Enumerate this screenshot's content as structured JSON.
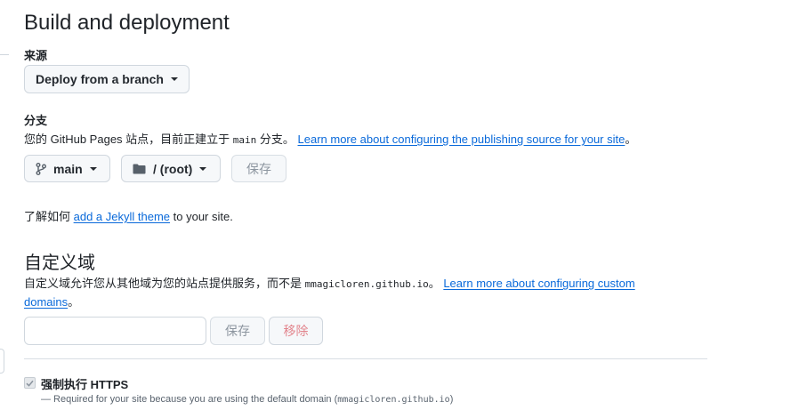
{
  "build": {
    "title": "Build and deployment",
    "source_label": "来源",
    "source_value": "Deploy from a branch"
  },
  "branch": {
    "label": "分支",
    "desc_prefix": "您的 GitHub Pages 站点，目前正建立于 ",
    "desc_code": "main",
    "desc_mid": " 分支。 ",
    "learn_link": "Learn more about configuring the publishing source for your site",
    "desc_end": "。",
    "branch_value": "main",
    "folder_value": "/ (root)",
    "save_label": "保存"
  },
  "jekyll": {
    "prefix": "了解如何 ",
    "link": "add a Jekyll theme",
    "suffix": " to your site."
  },
  "custom_domain": {
    "title": "自定义域",
    "desc_prefix": "自定义域允许您从其他域为您的站点提供服务，而不是 ",
    "desc_code": "mmagicloren.github.io",
    "desc_mid": "。 ",
    "learn_link_line1": "Learn more about configuring custom",
    "learn_link_line2": "domains",
    "desc_end": "。",
    "input_value": "",
    "save_label": "保存",
    "remove_label": "移除"
  },
  "https": {
    "label": "强制执行 HTTPS",
    "checked": true,
    "note_prefix": "— Required for your site because you are using the default domain (",
    "note_code": "mmagicloren.github.io",
    "note_suffix": ")"
  },
  "icons": [
    "git-branch-icon",
    "folder-icon",
    "caret-down-icon",
    "check-icon"
  ]
}
